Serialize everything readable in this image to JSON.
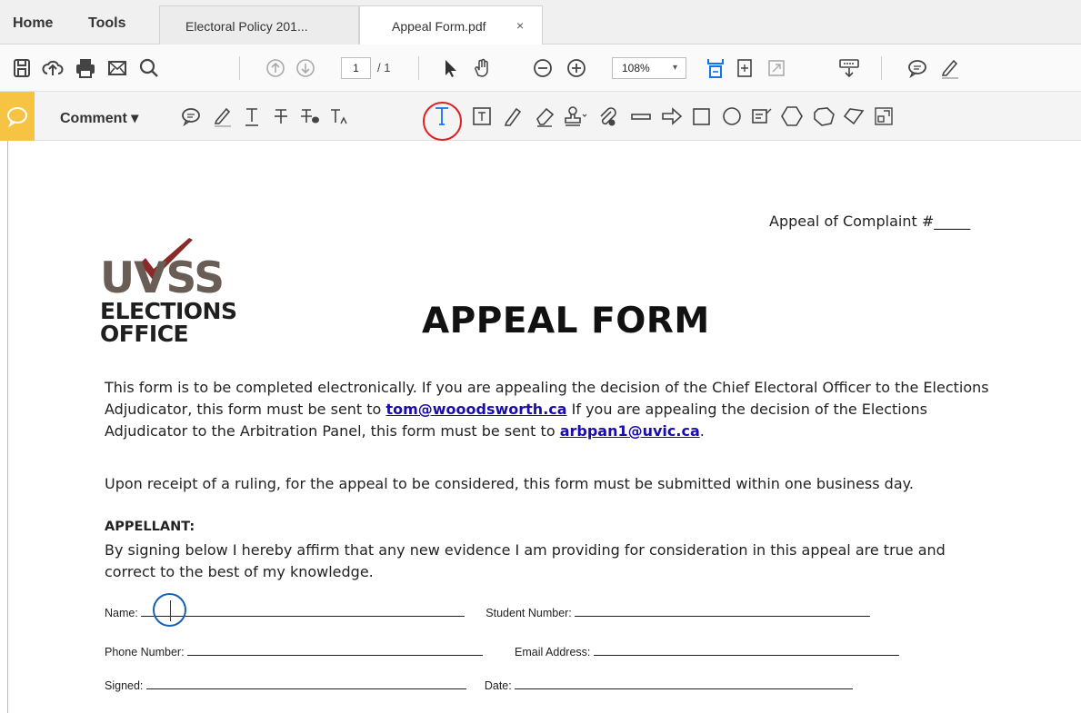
{
  "tabs": {
    "home": "Home",
    "tools": "Tools",
    "docs": [
      {
        "label": "Electoral Policy 201..."
      },
      {
        "label": "Appeal Form.pdf",
        "close": "×"
      }
    ]
  },
  "toolbar": {
    "page_current": "1",
    "page_total": "/ 1",
    "zoom": "108%",
    "zoom_caret": "▾"
  },
  "comment_toolbar": {
    "label": "Comment ▾"
  },
  "font_panel": {
    "font": "Helvetica"
  },
  "document": {
    "appeal_number": "Appeal of Complaint #_____",
    "logo": {
      "uvss": "UVSS",
      "line1": "ELECTIONS",
      "line2": "OFFICE"
    },
    "title": "APPEAL FORM",
    "intro": {
      "part1": "This form is to be completed electronically.  If you are appealing the decision of the Chief Electoral Officer to the Elections Adjudicator, this form must be sent to ",
      "email1": "tom@wooodsworth.ca",
      "part2": " If you are appealing the decision of the Elections Adjudicator to the Arbitration Panel, this form must be sent to ",
      "email2": "arbpan1@uvic.ca",
      "part3": "."
    },
    "receipt": "Upon receipt of a ruling, for the appeal to be considered, this form must be submitted within one business day.",
    "appellant_heading": "APPELLANT:",
    "affirm": "By signing below I hereby affirm that any new evidence I am providing for consideration in this appeal are true and correct to the best of my knowledge.",
    "fields": {
      "name": "Name:",
      "student_number": "Student Number:",
      "phone": "Phone Number:",
      "email": "Email Address:",
      "signed": "Signed:",
      "date": "Date:"
    }
  }
}
